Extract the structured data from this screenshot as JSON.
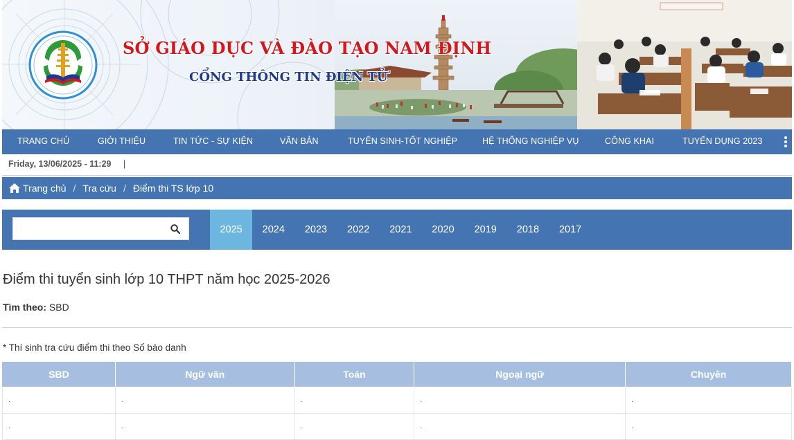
{
  "header": {
    "title": "SỞ GIÁO DỤC VÀ ĐÀO TẠO NAM ĐỊNH",
    "subtitle": "CỔNG THÔNG TIN ĐIỆN TỬ"
  },
  "nav": {
    "items": [
      "TRANG CHỦ",
      "GIỚI THIỆU",
      "TIN TỨC - SỰ KIỆN",
      "VĂN BẢN",
      "TUYỂN SINH-TỐT NGHIỆP",
      "HỆ THỐNG NGHIỆP VỤ",
      "CÔNG KHAI",
      "TUYỂN DỤNG 2023"
    ],
    "more_icon": "vertical-ellipsis-icon"
  },
  "date_bar": {
    "datetime": "Friday, 13/06/2025 - 11:29",
    "separator": "|"
  },
  "breadcrumb": {
    "home_icon": "home-icon",
    "items": [
      "Trang chủ",
      "Tra cứu",
      "Điểm thi TS lớp 10"
    ],
    "separator": "/"
  },
  "search": {
    "value": "",
    "placeholder": "",
    "icon": "search-icon"
  },
  "years": {
    "active": "2025",
    "items": [
      "2025",
      "2024",
      "2023",
      "2022",
      "2021",
      "2020",
      "2019",
      "2018",
      "2017"
    ]
  },
  "content": {
    "title": "Điểm thi tuyển sinh lớp 10 THPT năm học 2025-2026",
    "find_by_label": "Tìm theo:",
    "find_by_value": "SBD",
    "note": "* Thí sinh tra cứu điểm thi theo Số báo danh"
  },
  "table": {
    "headers": [
      "SBD",
      "Ngữ văn",
      "Toán",
      "Ngoại ngữ",
      "Chuyên"
    ],
    "rows": [
      [
        ".",
        ".",
        ".",
        ".",
        "."
      ],
      [
        ".",
        ".",
        ".",
        ".",
        "."
      ]
    ]
  },
  "colors": {
    "nav_blue": "#4574b3",
    "active_year": "#6cb6e0",
    "table_header": "#a6bfe0",
    "title_red": "#d4171d",
    "subtitle_blue": "#1d3a8f"
  }
}
